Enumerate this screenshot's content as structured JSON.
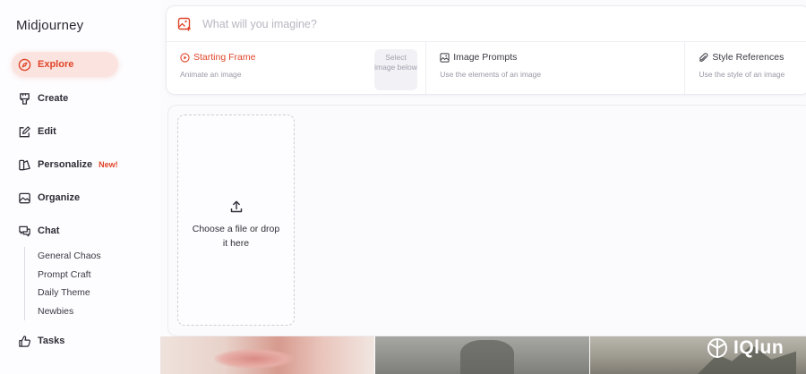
{
  "app": {
    "title": "Midjourney"
  },
  "sidebar": {
    "items": [
      {
        "label": "Explore",
        "icon": "compass-icon",
        "active": true
      },
      {
        "label": "Create",
        "icon": "paintbrush-icon"
      },
      {
        "label": "Edit",
        "icon": "edit-icon"
      },
      {
        "label": "Personalize",
        "icon": "personalize-icon",
        "badge": "New!"
      },
      {
        "label": "Organize",
        "icon": "image-icon"
      },
      {
        "label": "Chat",
        "icon": "chat-icon"
      },
      {
        "label": "Tasks",
        "icon": "thumbs-up-icon"
      }
    ],
    "chat_channels": [
      "General Chaos",
      "Prompt Craft",
      "Daily Theme",
      "Newbies"
    ]
  },
  "prompt": {
    "placeholder": "What will you imagine?",
    "icon": "add-image-icon"
  },
  "tabs": [
    {
      "title": "Starting Frame",
      "subtitle": "Animate an image",
      "icon": "play-circle-icon",
      "active": true,
      "side_label": "Select image below"
    },
    {
      "title": "Image Prompts",
      "subtitle": "Use the elements of an image",
      "icon": "image-grid-icon"
    },
    {
      "title": "Style References",
      "subtitle": "Use the style of an image",
      "icon": "paperclip-icon"
    }
  ],
  "dropzone": {
    "text": "Choose a file or drop it here",
    "icon": "upload-icon"
  },
  "watermark": {
    "text": "IQlun"
  },
  "colors": {
    "accent": "#e0452a",
    "active_bg": "#fbe4df"
  }
}
